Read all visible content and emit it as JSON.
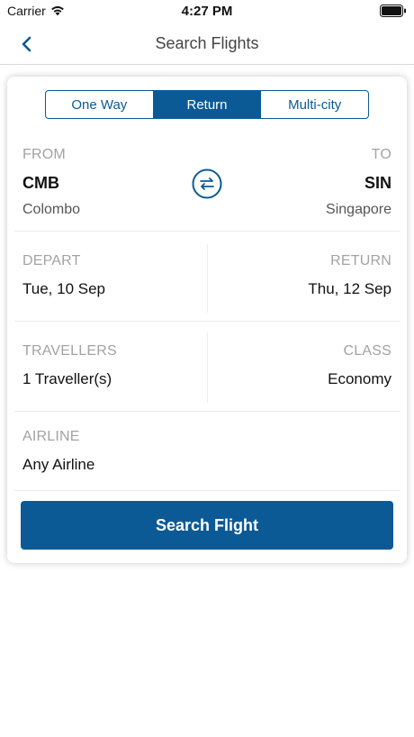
{
  "status_bar": {
    "carrier": "Carrier",
    "time": "4:27 PM",
    "wifi_icon": "wifi-icon",
    "battery_icon": "battery-icon"
  },
  "nav": {
    "title": "Search Flights",
    "back_icon": "chevron-left-icon"
  },
  "trip_types": [
    {
      "label": "One Way",
      "active": false
    },
    {
      "label": "Return",
      "active": true
    },
    {
      "label": "Multi-city",
      "active": false
    }
  ],
  "route": {
    "from": {
      "label": "FROM",
      "code": "CMB",
      "city": "Colombo"
    },
    "to": {
      "label": "TO",
      "code": "SIN",
      "city": "Singapore"
    },
    "swap_icon": "swap-arrows-icon"
  },
  "dates": {
    "depart": {
      "label": "DEPART",
      "value": "Tue, 10 Sep"
    },
    "return": {
      "label": "RETURN",
      "value": "Thu, 12 Sep"
    }
  },
  "passengers": {
    "travellers": {
      "label": "TRAVELLERS",
      "value": "1 Traveller(s)"
    },
    "class": {
      "label": "CLASS",
      "value": "Economy"
    }
  },
  "airline": {
    "label": "AIRLINE",
    "value": "Any Airline"
  },
  "search_button": "Search Flight",
  "colors": {
    "primary": "#0b5a96",
    "label_gray": "#a3a3a3"
  }
}
